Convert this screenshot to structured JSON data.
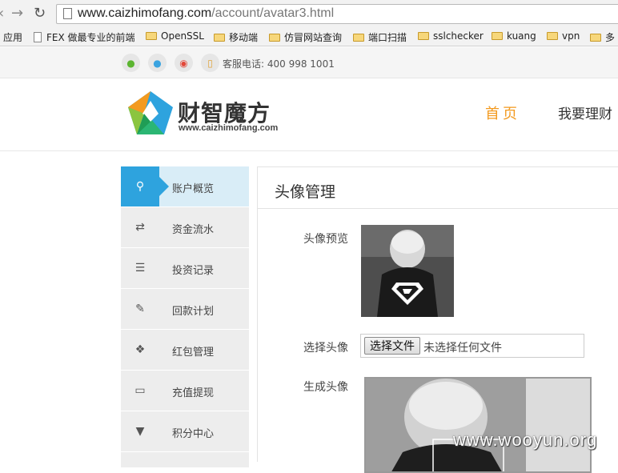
{
  "browser": {
    "url_host": "www.caizhimofang.com",
    "url_path": "/account/avatar3.html",
    "bookmarks": [
      "应用",
      "FEX 做最专业的前端",
      "OpenSSL",
      "移动端",
      "仿冒网站查询",
      "端口扫描",
      "sslchecker",
      "kuang",
      "vpn",
      "多"
    ]
  },
  "topbar": {
    "social_icons": [
      "wechat-icon",
      "qq-icon",
      "weibo-icon",
      "phone-icon"
    ],
    "hotline": "客服电话: 400 998 1001"
  },
  "header": {
    "logo_title": "财智魔方",
    "logo_sub": "www.caizhimofang.com",
    "nav": [
      "首页",
      "我要理财"
    ]
  },
  "sidebar": {
    "items": [
      {
        "label": "账户概览",
        "icon": "search-icon",
        "active": true
      },
      {
        "label": "资金流水",
        "icon": "transfer-icon",
        "active": false
      },
      {
        "label": "投资记录",
        "icon": "list-icon",
        "active": false
      },
      {
        "label": "回款计划",
        "icon": "edit-icon",
        "active": false
      },
      {
        "label": "红包管理",
        "icon": "gift-icon",
        "active": false
      },
      {
        "label": "充值提现",
        "icon": "card-icon",
        "active": false
      },
      {
        "label": "积分中心",
        "icon": "bookmark-icon",
        "active": false
      }
    ]
  },
  "main": {
    "title": "头像管理",
    "preview_label": "头像预览",
    "choose_label": "选择头像",
    "file_button": "选择文件",
    "file_status": "未选择任何文件",
    "generate_label": "生成头像"
  },
  "watermark": "www.wooyun.org",
  "colors": {
    "accent": "#2ea3de",
    "nav_active": "#f39a1f",
    "sidebar_bg": "#ededed",
    "sidebar_active": "#d9edf7"
  }
}
